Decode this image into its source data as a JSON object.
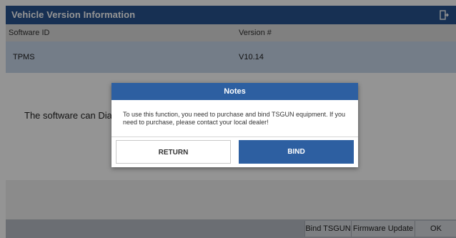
{
  "header": {
    "title": "Vehicle Version Information",
    "exit_icon": "exit-icon"
  },
  "table": {
    "columns": [
      "Software ID",
      "Version #"
    ],
    "rows": [
      {
        "id": "TPMS",
        "version": "V10.14"
      }
    ]
  },
  "description": "The software can Diagno",
  "bottom_buttons": [
    "Bind TSGUN",
    "Firmware Update",
    "OK"
  ],
  "dialog": {
    "title": "Notes",
    "message": "To use this function, you need to purchase and bind TSGUN equipment. If you need to purchase, please contact your local dealer!",
    "return_label": "RETURN",
    "bind_label": "BIND"
  },
  "colors": {
    "header": "#29538f",
    "dialog_accent": "#2d5fa1",
    "selected_row": "#c9d7ea"
  }
}
